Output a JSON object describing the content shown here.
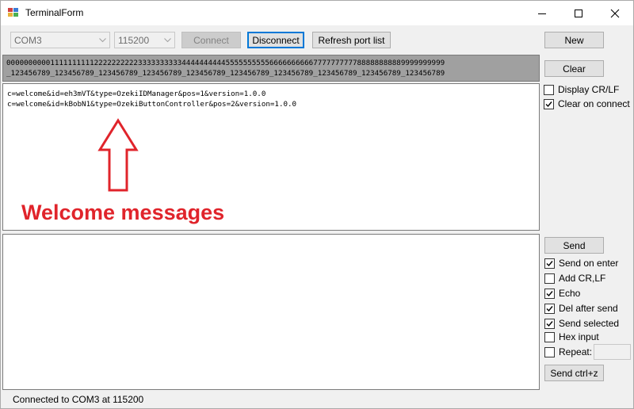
{
  "window": {
    "title": "TerminalForm",
    "controls": {
      "minimize": "minimize-icon",
      "maximize": "maximize-icon",
      "close": "close-icon"
    }
  },
  "toolbar": {
    "port": {
      "value": "COM3",
      "enabled": false
    },
    "baud": {
      "value": "115200",
      "enabled": false
    },
    "connect_label": "Connect",
    "disconnect_label": "Disconnect",
    "refresh_label": "Refresh port list"
  },
  "ruler": {
    "line1": "0000000000111111111122222222223333333333444444444455555555556666666666777777777788888888889999999999",
    "line2": "_123456789_123456789_123456789_123456789_123456789_123456789_123456789_123456789_123456789_123456789"
  },
  "received": {
    "lines": [
      "c=welcome&id=eh3mVT&type=OzekiIDManager&pos=1&version=1.0.0",
      "c=welcome&id=kBobN1&type=OzekiButtonController&pos=2&version=1.0.0"
    ]
  },
  "annotation": {
    "text": "Welcome messages",
    "color": "#e0242b"
  },
  "right_panel": {
    "new_label": "New",
    "clear_label": "Clear",
    "display_crlf": {
      "label": "Display CR/LF",
      "checked": false
    },
    "clear_on_connect": {
      "label": "Clear on connect",
      "checked": true
    }
  },
  "send_panel": {
    "send_label": "Send",
    "options": [
      {
        "label": "Send on enter",
        "checked": true
      },
      {
        "label": "Add CR,LF",
        "checked": false
      },
      {
        "label": "Echo",
        "checked": true
      },
      {
        "label": "Del after send",
        "checked": true
      },
      {
        "label": "Send selected",
        "checked": true
      },
      {
        "label": "Hex input",
        "checked": false
      },
      {
        "label": "Repeat:",
        "checked": false
      }
    ],
    "repeat_value": "",
    "send_ctrlz_label": "Send ctrl+z"
  },
  "status": {
    "text": "Connected to COM3 at 115200"
  }
}
